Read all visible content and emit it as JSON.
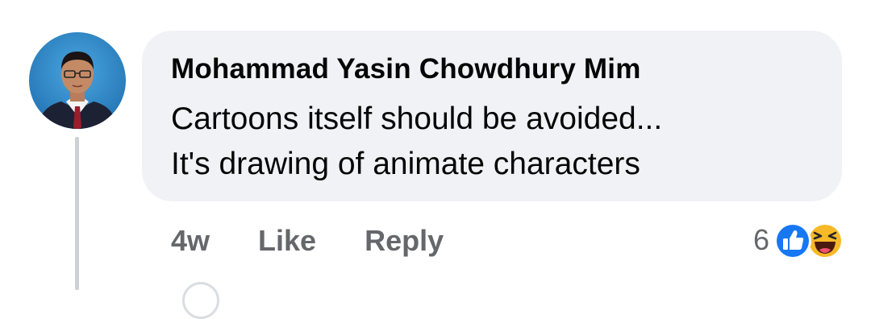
{
  "comment": {
    "author": "Mohammad Yasin Chowdhury Mim",
    "body_lines": [
      "Cartoons itself should be avoided...",
      "It's drawing of animate characters"
    ],
    "timestamp": "4w",
    "like_label": "Like",
    "reply_label": "Reply",
    "reaction_count": "6",
    "reactions": [
      "like-icon",
      "haha-icon"
    ]
  },
  "colors": {
    "bubble_bg": "#f0f2f5",
    "meta_text": "#65676b",
    "like_blue": "#1877f2",
    "haha_yellow": "#f7b928"
  }
}
